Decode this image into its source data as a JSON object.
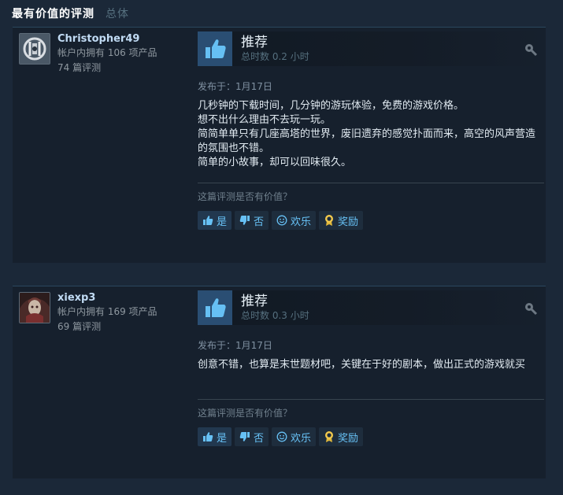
{
  "section": {
    "title": "最有价值的评测",
    "subtitle": "总体"
  },
  "colors": {
    "background": "#1b2838",
    "card": "#16202d",
    "link_blue": "#67c1f5",
    "thumb_bg": "#2a4e73",
    "thumb_fg": "#66c0f4"
  },
  "reviews": [
    {
      "author": {
        "name": "Christopher49",
        "products": "帐户内拥有 106 项产品",
        "reviews": "74 篇评测",
        "avatar_icon": "rainbow-six-siege-logo-avatar"
      },
      "verdict": "推荐",
      "hours": "总时数 0.2 小时",
      "posted": "发布于：1月17日",
      "content": "几秒钟的下载时间，几分钟的游玩体验，免费的游戏价格。\n想不出什么理由不去玩一玩。\n简简单单只有几座高塔的世界，废旧遗弃的感觉扑面而来，高空的风声营造的氛围也不错。\n简单的小故事，却可以回味很久。",
      "helpful_question": "这篇评测是否有价值？",
      "buttons": {
        "yes": "是",
        "no": "否",
        "funny": "欢乐",
        "award": "奖励"
      }
    },
    {
      "author": {
        "name": "xiexp3",
        "products": "帐户内拥有 169 项产品",
        "reviews": "69 篇评测",
        "avatar_icon": "dark-character-portrait-avatar"
      },
      "verdict": "推荐",
      "hours": "总时数 0.3 小时",
      "posted": "发布于：1月17日",
      "content": "创意不错，也算是末世题材吧，关键在于好的剧本，做出正式的游戏就买",
      "helpful_question": "这篇评测是否有价值？",
      "buttons": {
        "yes": "是",
        "no": "否",
        "funny": "欢乐",
        "award": "奖励"
      }
    }
  ]
}
